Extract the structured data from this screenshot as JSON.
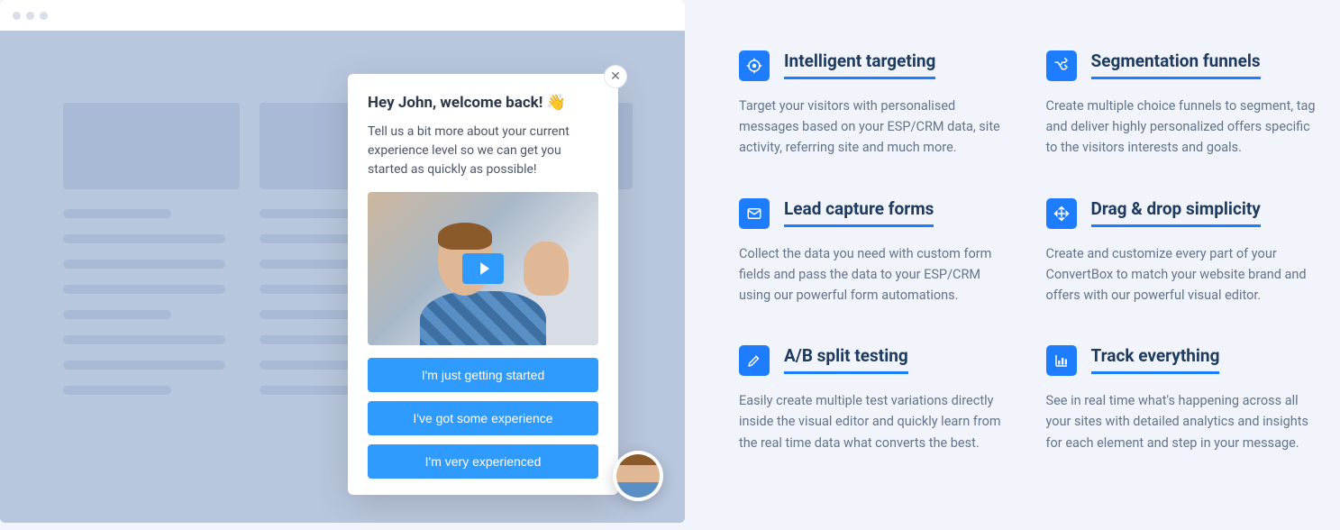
{
  "popup": {
    "heading": "Hey John, welcome back! 👋",
    "subtext": "Tell us a bit more about your current experience level so we can get you started as quickly as possible!",
    "options": [
      "I'm just getting started",
      "I've got some experience",
      "I'm very experienced"
    ]
  },
  "features": [
    {
      "icon": "target",
      "title": "Intelligent targeting",
      "desc": "Target your visitors with personalised messages based on your ESP/CRM data, site activity, referring site and much more."
    },
    {
      "icon": "shuffle",
      "title": "Segmentation funnels",
      "desc": "Create multiple choice funnels to segment, tag and deliver highly personalized offers specific to the visitors interests and goals."
    },
    {
      "icon": "mail",
      "title": "Lead capture forms",
      "desc": "Collect the data you need with custom form fields and pass the data to your ESP/CRM using our powerful form automations."
    },
    {
      "icon": "move",
      "title": "Drag & drop simplicity",
      "desc": "Create and customize every part of your ConvertBox to match your website brand and offers with our powerful visual editor."
    },
    {
      "icon": "edit",
      "title": "A/B split testing",
      "desc": "Easily create multiple test variations directly inside the visual editor and quickly learn from the real time data what converts the best."
    },
    {
      "icon": "chart",
      "title": "Track everything",
      "desc": "See in real time what's happening across all your sites with detailed analytics and insights for each element and step in your message."
    }
  ]
}
